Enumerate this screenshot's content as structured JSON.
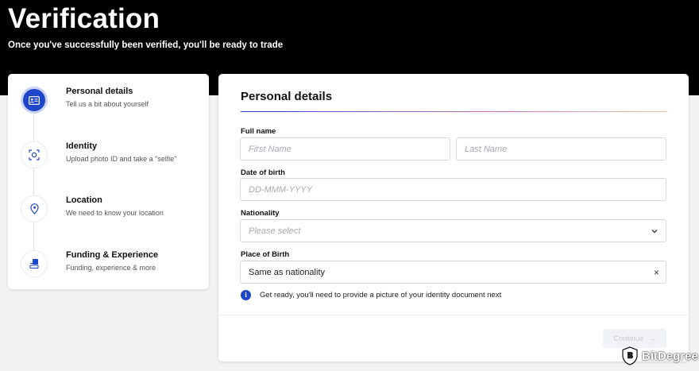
{
  "header": {
    "title": "Verification",
    "subtitle": "Once you've successfully been verified, you'll be ready to trade"
  },
  "steps": [
    {
      "title": "Personal details",
      "subtitle": "Tell us a bit about yourself",
      "icon": "id-card-icon",
      "active": true
    },
    {
      "title": "Identity",
      "subtitle": "Upload photo ID and take a \"selfie\"",
      "icon": "face-scan-icon",
      "active": false
    },
    {
      "title": "Location",
      "subtitle": "We need to know your location",
      "icon": "location-pin-icon",
      "active": false
    },
    {
      "title": "Funding & Experience",
      "subtitle": "Funding, experience & more",
      "icon": "funding-icon",
      "active": false
    }
  ],
  "form": {
    "title": "Personal details",
    "full_name": {
      "label": "Full name",
      "first_placeholder": "First Name",
      "last_placeholder": "Last Name"
    },
    "dob": {
      "label": "Date of birth",
      "placeholder": "DD-MMM-YYYY"
    },
    "nationality": {
      "label": "Nationality",
      "placeholder": "Please select"
    },
    "place_of_birth": {
      "label": "Place of Birth",
      "value": "Same as nationality",
      "clear_glyph": "×"
    },
    "info": {
      "glyph": "i",
      "text": "Get ready, you'll need to provide a picture of your identity document next"
    },
    "continue_label": "Continue",
    "continue_arrow": "→"
  },
  "watermark": {
    "brand": "BitDegree"
  },
  "colors": {
    "accent": "#1f45c9",
    "header_bg": "#000000",
    "page_bg": "#f2f2f3"
  }
}
